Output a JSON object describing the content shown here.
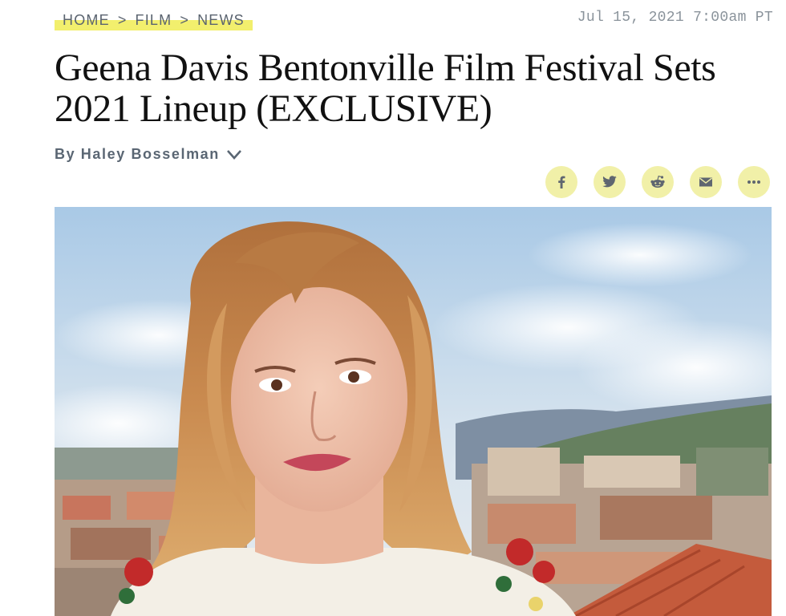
{
  "breadcrumb": {
    "items": [
      "HOME",
      "FILM",
      "NEWS"
    ],
    "separator": ">",
    "highlight_color": "#f2ef6d"
  },
  "dateline": "Jul 15, 2021 7:00am PT",
  "article": {
    "headline_line1": "Geena Davis Bentonville Film Festival Sets",
    "headline_line2": "2021 Lineup (EXCLUSIVE)",
    "byline": "By Haley Bosselman"
  },
  "share": {
    "button_color": "#f1f0a8",
    "icons": [
      "facebook-icon",
      "twitter-icon",
      "reddit-icon",
      "email-icon",
      "more-icon"
    ]
  },
  "hero_image": {
    "subject": "portrait photo of a woman with shoulder-length strawberry blonde hair against a blue sky and city rooftops"
  }
}
